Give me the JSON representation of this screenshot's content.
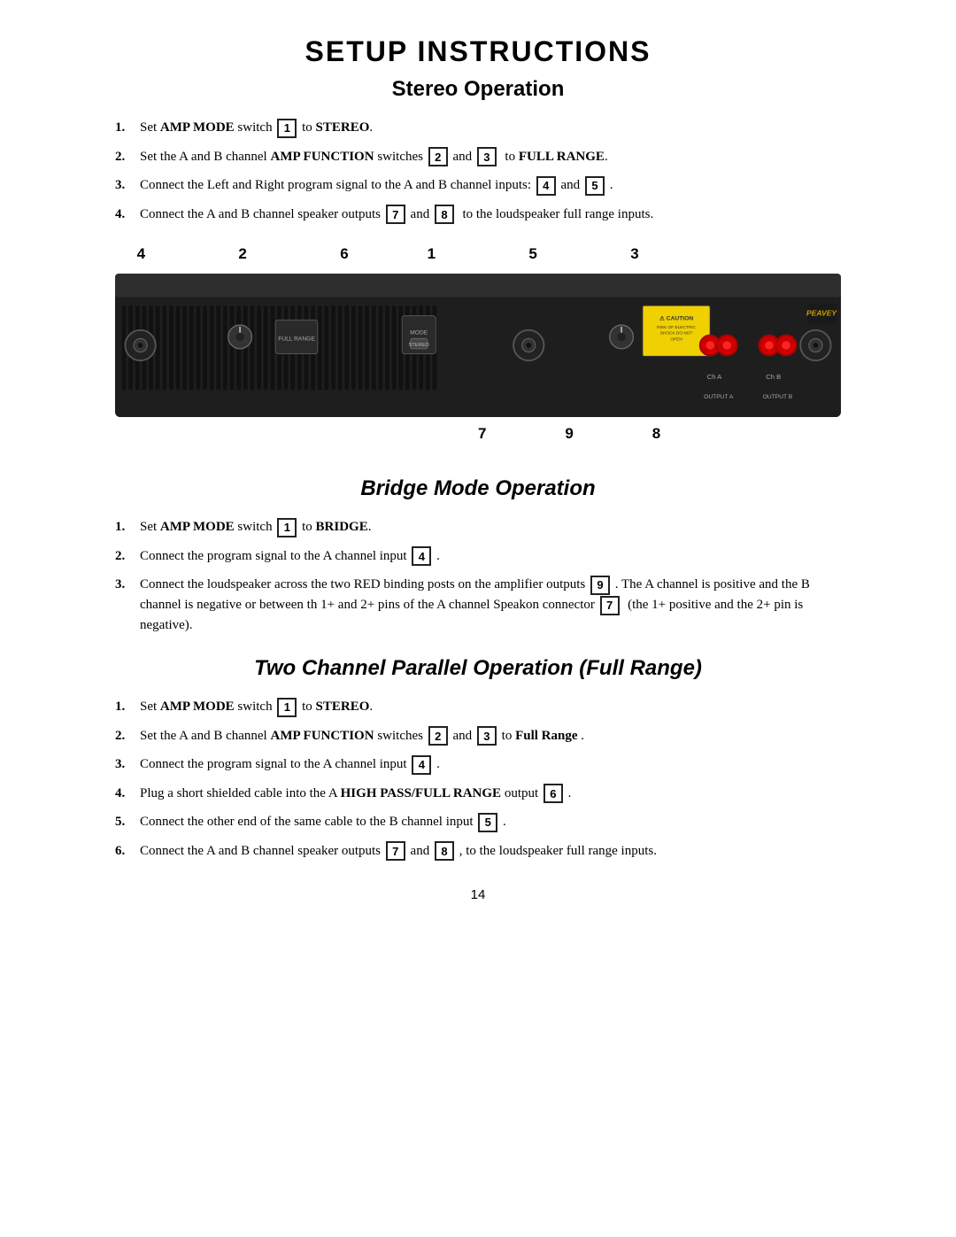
{
  "page": {
    "title": "SETUP INSTRUCTIONS",
    "page_number": "14"
  },
  "stereo_section": {
    "title": "Stereo Operation",
    "steps": [
      {
        "num": "1.",
        "parts": [
          {
            "text": "Set ",
            "bold": false
          },
          {
            "text": "AMP MODE",
            "bold": true
          },
          {
            "text": " switch ",
            "bold": false
          },
          {
            "badge": "1"
          },
          {
            "text": " to ",
            "bold": false
          },
          {
            "text": "STEREO",
            "bold": true
          },
          {
            "text": ".",
            "bold": false
          }
        ]
      },
      {
        "num": "2.",
        "parts": [
          {
            "text": "Set the A and B channel ",
            "bold": false
          },
          {
            "text": "AMP FUNCTION",
            "bold": true
          },
          {
            "text": " switches ",
            "bold": false
          },
          {
            "badge": "2"
          },
          {
            "text": " and ",
            "bold": false
          },
          {
            "badge": "3"
          },
          {
            "text": "  to ",
            "bold": false
          },
          {
            "text": "FULL RANGE",
            "bold": true
          },
          {
            "text": ".",
            "bold": false
          }
        ]
      },
      {
        "num": "3.",
        "parts": [
          {
            "text": "Connect the Left and Right program signal to the A and B channel inputs: ",
            "bold": false
          },
          {
            "badge": "4"
          },
          {
            "text": " and ",
            "bold": false
          },
          {
            "badge": "5"
          },
          {
            "text": " .",
            "bold": false
          }
        ]
      },
      {
        "num": "4.",
        "parts": [
          {
            "text": "Connect the A and B channel speaker outputs ",
            "bold": false
          },
          {
            "badge": "7"
          },
          {
            "text": " and ",
            "bold": false
          },
          {
            "badge": "8"
          },
          {
            "text": "  to the loudspeaker full range inputs.",
            "bold": false
          }
        ]
      }
    ]
  },
  "amp_diagram": {
    "top_labels": [
      {
        "num": "4",
        "pos": 4
      },
      {
        "num": "2",
        "pos": 16
      },
      {
        "num": "6",
        "pos": 28
      },
      {
        "num": "1",
        "pos": 38
      },
      {
        "num": "5",
        "pos": 52
      },
      {
        "num": "3",
        "pos": 64
      }
    ],
    "bottom_labels": [
      {
        "num": "7",
        "pos": 52
      },
      {
        "num": "9",
        "pos": 62
      },
      {
        "num": "8",
        "pos": 74
      }
    ]
  },
  "bridge_section": {
    "title": "Bridge Mode Operation",
    "steps": [
      {
        "num": "1.",
        "parts": [
          {
            "text": "Set ",
            "bold": false
          },
          {
            "text": "AMP MODE",
            "bold": true
          },
          {
            "text": " switch ",
            "bold": false
          },
          {
            "badge": "1"
          },
          {
            "text": " to ",
            "bold": false
          },
          {
            "text": "BRIDGE",
            "bold": true
          },
          {
            "text": ".",
            "bold": false
          }
        ]
      },
      {
        "num": "2.",
        "parts": [
          {
            "text": "Connect the program signal to the A channel input ",
            "bold": false
          },
          {
            "badge": "4"
          },
          {
            "text": " .",
            "bold": false
          }
        ]
      },
      {
        "num": "3.",
        "parts": [
          {
            "text": "Connect the loudspeaker across the two RED binding posts on the amplifier outputs ",
            "bold": false
          },
          {
            "badge": "9"
          },
          {
            "text": " . The A channel is positive and the B channel is negative or between th 1+ and 2+ pins of the A channel Speakon connector ",
            "bold": false
          },
          {
            "badge": "7"
          },
          {
            "text": "  (the 1+ positive and the 2+ pin is negative).",
            "bold": false
          }
        ]
      }
    ]
  },
  "parallel_section": {
    "title": "Two Channel Parallel Operation (Full Range)",
    "steps": [
      {
        "num": "1.",
        "parts": [
          {
            "text": "Set ",
            "bold": false
          },
          {
            "text": "AMP MODE",
            "bold": true
          },
          {
            "text": " switch ",
            "bold": false
          },
          {
            "badge": "1"
          },
          {
            "text": " to ",
            "bold": false
          },
          {
            "text": "STEREO",
            "bold": true
          },
          {
            "text": ".",
            "bold": false
          }
        ]
      },
      {
        "num": "2.",
        "parts": [
          {
            "text": "Set the A and B channel ",
            "bold": false
          },
          {
            "text": "AMP FUNCTION",
            "bold": true
          },
          {
            "text": " switches ",
            "bold": false
          },
          {
            "badge": "2"
          },
          {
            "text": " and ",
            "bold": false
          },
          {
            "badge": "3"
          },
          {
            "text": " to ",
            "bold": false
          },
          {
            "text": "Full Range",
            "bold": true
          },
          {
            "text": " .",
            "bold": false
          }
        ]
      },
      {
        "num": "3.",
        "parts": [
          {
            "text": "Connect the program signal to the A channel input ",
            "bold": false
          },
          {
            "badge": "4"
          },
          {
            "text": " .",
            "bold": false
          }
        ]
      },
      {
        "num": "4.",
        "parts": [
          {
            "text": "Plug a short shielded cable into the A ",
            "bold": false
          },
          {
            "text": "HIGH PASS/FULL RANGE",
            "bold": true
          },
          {
            "text": " output ",
            "bold": false
          },
          {
            "badge": "6"
          },
          {
            "text": " .",
            "bold": false
          }
        ]
      },
      {
        "num": "5.",
        "parts": [
          {
            "text": "Connect the other end of the same cable to the B channel input ",
            "bold": false
          },
          {
            "badge": "5"
          },
          {
            "text": " .",
            "bold": false
          }
        ]
      },
      {
        "num": "6.",
        "parts": [
          {
            "text": "Connect the A and B channel speaker outputs ",
            "bold": false
          },
          {
            "badge": "7"
          },
          {
            "text": " and ",
            "bold": false
          },
          {
            "badge": "8"
          },
          {
            "text": " , to the loudspeaker full range inputs.",
            "bold": false
          }
        ]
      }
    ]
  }
}
